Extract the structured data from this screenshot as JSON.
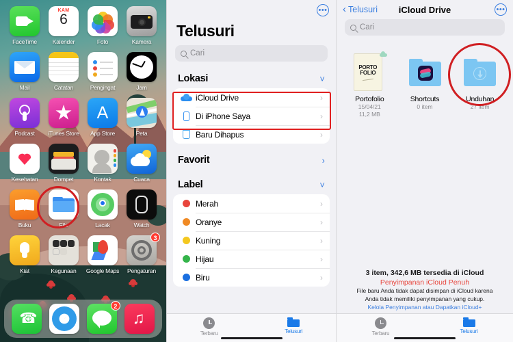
{
  "home_screen": {
    "apps": [
      [
        {
          "label": "FaceTime",
          "icon": "facetime-icon"
        },
        {
          "label": "Kalender",
          "icon": "calendar-icon",
          "day_name": "KAM",
          "day_num": "6"
        },
        {
          "label": "Foto",
          "icon": "photos-icon"
        },
        {
          "label": "Kamera",
          "icon": "camera-icon"
        }
      ],
      [
        {
          "label": "Mail",
          "icon": "mail-icon"
        },
        {
          "label": "Catatan",
          "icon": "notes-icon"
        },
        {
          "label": "Pengingat",
          "icon": "reminders-icon"
        },
        {
          "label": "Jam",
          "icon": "clock-icon"
        }
      ],
      [
        {
          "label": "Podcast",
          "icon": "podcasts-icon"
        },
        {
          "label": "iTunes Store",
          "icon": "itunes-store-icon"
        },
        {
          "label": "App Store",
          "icon": "app-store-icon"
        },
        {
          "label": "Peta",
          "icon": "maps-icon"
        }
      ],
      [
        {
          "label": "Kesehatan",
          "icon": "health-icon"
        },
        {
          "label": "Dompet",
          "icon": "wallet-icon"
        },
        {
          "label": "Kontak",
          "icon": "contacts-icon"
        },
        {
          "label": "Cuaca",
          "icon": "weather-icon"
        }
      ],
      [
        {
          "label": "Buku",
          "icon": "books-icon"
        },
        {
          "label": "File",
          "icon": "files-icon",
          "highlighted": true
        },
        {
          "label": "Lacak",
          "icon": "find-my-icon"
        },
        {
          "label": "Watch",
          "icon": "watch-icon"
        }
      ],
      [
        {
          "label": "Kiat",
          "icon": "tips-icon"
        },
        {
          "label": "Kegunaan",
          "icon": "utilities-folder-icon"
        },
        {
          "label": "Google Maps",
          "icon": "google-maps-icon"
        },
        {
          "label": "Pengaturan",
          "icon": "settings-icon",
          "badge": "3"
        }
      ]
    ],
    "dock": [
      {
        "label": "Telepon",
        "icon": "phone-icon"
      },
      {
        "label": "Safari",
        "icon": "safari-icon"
      },
      {
        "label": "Pesan",
        "icon": "messages-icon",
        "badge": "2"
      },
      {
        "label": "Musik",
        "icon": "music-icon"
      }
    ]
  },
  "browse_panel": {
    "title": "Telusuri",
    "more_button": "•••",
    "search": {
      "placeholder": "Cari",
      "icon": "search-icon"
    },
    "sections": [
      {
        "heading": "Lokasi",
        "collapse_icon": "chevron-down-icon",
        "items": [
          {
            "label": "iCloud Drive",
            "icon": "icloud-icon",
            "chevron": "›"
          },
          {
            "label": "Di iPhone Saya",
            "icon": "iphone-icon",
            "chevron": "›"
          },
          {
            "label": "Baru Dihapus",
            "icon": "trash-icon",
            "chevron": "›"
          }
        ]
      },
      {
        "heading": "Favorit",
        "collapse_icon": "chevron-right-icon",
        "items": []
      },
      {
        "heading": "Label",
        "collapse_icon": "chevron-down-icon",
        "items": [
          {
            "label": "Merah",
            "color": "#e8453c",
            "chevron": "›"
          },
          {
            "label": "Oranye",
            "color": "#f08a24",
            "chevron": "›"
          },
          {
            "label": "Kuning",
            "color": "#f4c81f",
            "chevron": "›"
          },
          {
            "label": "Hijau",
            "color": "#34b44a",
            "chevron": "›"
          },
          {
            "label": "Biru",
            "color": "#1a6fe0",
            "chevron": "›"
          }
        ]
      }
    ],
    "tabbar": [
      {
        "label": "Terbaru",
        "icon": "recents-clock-icon",
        "active": false
      },
      {
        "label": "Telusuri",
        "icon": "browse-folder-icon",
        "active": true
      }
    ]
  },
  "drive_panel": {
    "back_label": "Telusuri",
    "back_icon": "chevron-left-icon",
    "title": "iCloud Drive",
    "more_button": "•••",
    "search": {
      "placeholder": "Cari",
      "icon": "search-icon"
    },
    "files": [
      {
        "name": "Portofolio",
        "type": "document",
        "thumb_text_1": "PORTO",
        "thumb_text_2": "FOLIO",
        "meta_1": "15/04/21",
        "meta_2": "11,2 MB",
        "cloud_badge": true,
        "highlighted": false
      },
      {
        "name": "Shortcuts",
        "type": "folder",
        "meta_1": "0 item",
        "meta_2": "",
        "highlighted": false
      },
      {
        "name": "Unduhan",
        "type": "folder-download",
        "meta_1": "27 item",
        "meta_2": "",
        "highlighted": true
      }
    ],
    "storage": {
      "summary": "3 item, 342,6 MB tersedia di iCloud",
      "warning": "Penyimpanan iCloud Penuh",
      "description_line1": "File baru Anda tidak dapat disimpan di iCloud karena",
      "description_line2": "Anda tidak memiliki penyimpanan yang cukup.",
      "link": "Kelola Penyimpanan atau Dapatkan iCloud+"
    },
    "tabbar": [
      {
        "label": "Terbaru",
        "icon": "recents-clock-icon",
        "active": false
      },
      {
        "label": "Telusuri",
        "icon": "browse-folder-icon",
        "active": true
      }
    ]
  },
  "annotations": {
    "colors": {
      "highlight_red": "#e02020",
      "circle_red": "#d01f22",
      "ios_blue": "#3c7fe0"
    }
  }
}
